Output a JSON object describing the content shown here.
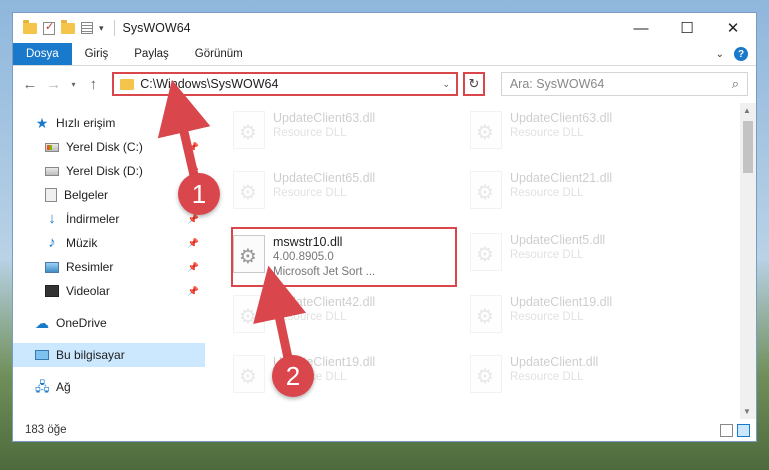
{
  "window": {
    "title": "SysWOW64",
    "controls": {
      "minimize": "—",
      "maximize": "☐",
      "close": "✕"
    }
  },
  "ribbon": {
    "tabs": [
      "Dosya",
      "Giriş",
      "Paylaş",
      "Görünüm"
    ],
    "help": "?"
  },
  "nav": {
    "back": "←",
    "forward": "→",
    "recent": "▾",
    "up": "↑",
    "address": "C:\\Windows\\SysWOW64",
    "refresh": "↻",
    "search_placeholder": "Ara: SysWOW64",
    "search_icon": "⌕"
  },
  "sidebar": {
    "quick_access": "Hızlı erişim",
    "items": [
      {
        "label": "Yerel Disk (C:)",
        "icon": "drive-c-icon",
        "pinned": true
      },
      {
        "label": "Yerel Disk (D:)",
        "icon": "drive-icon",
        "pinned": true
      },
      {
        "label": "Belgeler",
        "icon": "documents-icon",
        "pinned": true
      },
      {
        "label": "İndirmeler",
        "icon": "downloads-icon",
        "pinned": true
      },
      {
        "label": "Müzik",
        "icon": "music-icon",
        "pinned": true
      },
      {
        "label": "Resimler",
        "icon": "pictures-icon",
        "pinned": true
      },
      {
        "label": "Videolar",
        "icon": "videos-icon",
        "pinned": true
      }
    ],
    "onedrive": "OneDrive",
    "this_pc": "Bu bilgisayar",
    "network": "Ağ"
  },
  "files": [
    {
      "name": "UpdateClient63.dll",
      "meta": "Resource DLL",
      "faded": true
    },
    {
      "name": "UpdateClient65.dll",
      "meta": "Resource DLL",
      "faded": true
    },
    {
      "name": "mswstr10.dll",
      "meta": "4.00.8905.0",
      "meta2": "Microsoft Jet Sort ...",
      "faded": false
    },
    {
      "name": "UpdateClient42.dll",
      "meta": "Resource DLL",
      "faded": true
    },
    {
      "name": "UpdateClient19.dll",
      "meta": "Resource DLL",
      "faded": true
    },
    {
      "name": "UpdateClient63.dll",
      "meta": "Resource DLL",
      "faded": true
    },
    {
      "name": "UpdateClient21.dll",
      "meta": "Resource DLL",
      "faded": true
    },
    {
      "name": "UpdateClient5.dll",
      "meta": "Resource DLL",
      "faded": true
    },
    {
      "name": "UpdateClient19.dll",
      "meta": "Resource DLL",
      "faded": true
    },
    {
      "name": "UpdateClient.dll",
      "meta": "Resource DLL",
      "faded": true
    }
  ],
  "status": {
    "count": "183 öğe"
  },
  "annotations": {
    "callout1": "1",
    "callout2": "2"
  },
  "colors": {
    "accent": "#1979ca",
    "highlight_red": "#d9464c",
    "selected_bg": "#cce8ff"
  }
}
